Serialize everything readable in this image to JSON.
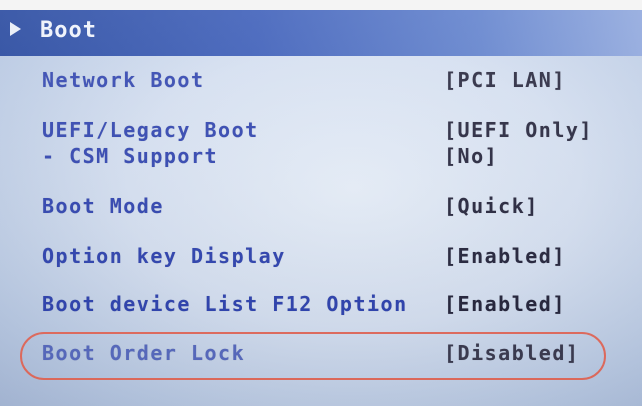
{
  "header": {
    "title": "Boot"
  },
  "rows": [
    {
      "label": "Network Boot",
      "value": "[PCI LAN]"
    },
    {
      "label": "UEFI/Legacy Boot",
      "value": "[UEFI Only]",
      "sub_label": "- CSM Support",
      "sub_value": "[No]"
    },
    {
      "label": "Boot Mode",
      "value": "[Quick]"
    },
    {
      "label": "Option key Display",
      "value": "[Enabled]"
    },
    {
      "label": "Boot device List F12 Option",
      "value": "[Enabled]"
    },
    {
      "label": "Boot Order Lock",
      "value": "[Disabled]",
      "highlighted": true
    }
  ],
  "colors": {
    "header": "#2a4aa8",
    "label": "#2a3fae",
    "value": "#202038",
    "highlight_ring": "#e36a5c"
  }
}
